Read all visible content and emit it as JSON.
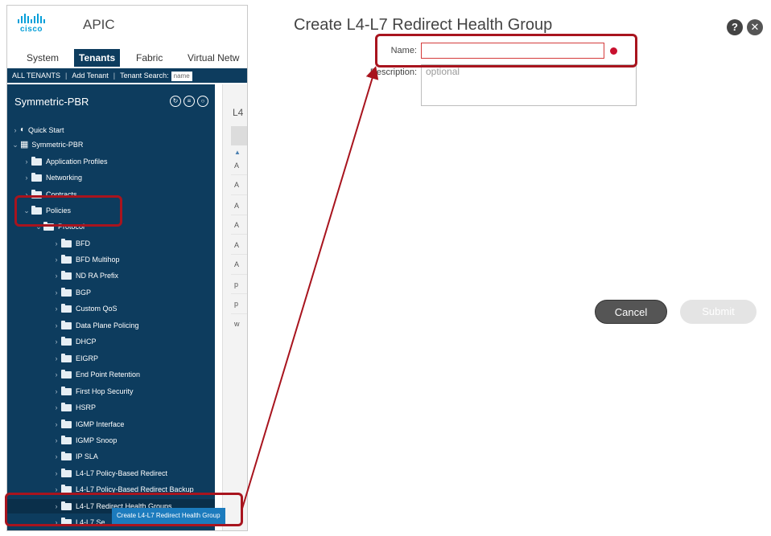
{
  "app": {
    "logo_text": "cisco",
    "title": "APIC"
  },
  "tabs": [
    {
      "label": "System",
      "active": false
    },
    {
      "label": "Tenants",
      "active": true
    },
    {
      "label": "Fabric",
      "active": false
    },
    {
      "label": "Virtual Netw",
      "active": false
    }
  ],
  "subbar": {
    "all_tenants": "ALL TENANTS",
    "separator": "|",
    "add_tenant": "Add Tenant",
    "tenant_search_label": "Tenant Search:",
    "tenant_search_placeholder": "name"
  },
  "nav": {
    "title": "Symmetric-PBR",
    "tool_icons": [
      "refresh-icon",
      "list-icon",
      "settings-icon"
    ],
    "items": [
      {
        "label": "Quick Start",
        "icon": "quick-start-icon"
      },
      {
        "label": "Symmetric-PBR",
        "icon": "tenant-icon"
      },
      {
        "label": "Application Profiles",
        "icon": "folder-icon"
      },
      {
        "label": "Networking",
        "icon": "folder-icon"
      },
      {
        "label": "Contracts",
        "icon": "folder-icon"
      },
      {
        "label": "Policies",
        "icon": "folder-icon"
      },
      {
        "label": "Protocol",
        "icon": "folder-icon"
      },
      {
        "label": "BFD",
        "icon": "folder-icon"
      },
      {
        "label": "BFD Multihop",
        "icon": "folder-icon"
      },
      {
        "label": "ND RA Prefix",
        "icon": "folder-icon"
      },
      {
        "label": "BGP",
        "icon": "folder-icon"
      },
      {
        "label": "Custom QoS",
        "icon": "folder-icon"
      },
      {
        "label": "Data Plane Policing",
        "icon": "folder-icon"
      },
      {
        "label": "DHCP",
        "icon": "folder-icon"
      },
      {
        "label": "EIGRP",
        "icon": "folder-icon"
      },
      {
        "label": "End Point Retention",
        "icon": "folder-icon"
      },
      {
        "label": "First Hop Security",
        "icon": "folder-icon"
      },
      {
        "label": "HSRP",
        "icon": "folder-icon"
      },
      {
        "label": "IGMP Interface",
        "icon": "folder-icon"
      },
      {
        "label": "IGMP Snoop",
        "icon": "folder-icon"
      },
      {
        "label": "IP SLA",
        "icon": "folder-icon"
      },
      {
        "label": "L4-L7 Policy-Based Redirect",
        "icon": "folder-icon"
      },
      {
        "label": "L4-L7 Policy-Based Redirect Backup",
        "icon": "folder-icon"
      },
      {
        "label": "L4-L7 Redirect Health Groups",
        "icon": "folder-icon"
      },
      {
        "label": "L4-L7 Se",
        "icon": "folder-icon"
      }
    ],
    "context_menu_item": "Create L4-L7 Redirect Health Group"
  },
  "side_list": {
    "header": "L4",
    "sort_mark": "▲",
    "cells": [
      "A",
      "A",
      "A",
      "A",
      "A",
      "A",
      "p",
      "p",
      "w"
    ]
  },
  "dialog": {
    "title": "Create L4-L7 Redirect Health Group",
    "help_icon": "?",
    "close_icon": "✕",
    "name_label": "Name:",
    "name_value": "",
    "description_label": "Description:",
    "description_placeholder": "optional",
    "cancel_label": "Cancel",
    "submit_label": "Submit"
  },
  "annotation": {
    "highlight_color": "#a8141e"
  }
}
